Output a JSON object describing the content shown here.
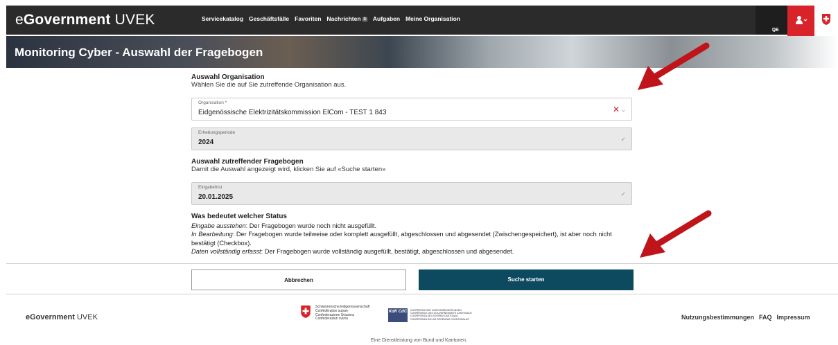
{
  "header": {
    "brand_prefix": "e",
    "brand_main": "Government",
    "brand_suffix": " UVEK",
    "nav": [
      {
        "label": "Servicekatalog"
      },
      {
        "label": "Geschäftsfälle"
      },
      {
        "label": "Favoriten"
      },
      {
        "label": "Nachrichten",
        "badge": "3"
      },
      {
        "label": "Aufgaben"
      },
      {
        "label": "Meine Organisation"
      }
    ],
    "language": "DE",
    "icons": {
      "language_dropdown": "chevron-down-icon",
      "user": "user-icon",
      "flag": "swiss-cross-icon"
    }
  },
  "hero": {
    "title": "Monitoring Cyber - Auswahl der Fragebogen"
  },
  "org_section": {
    "title": "Auswahl Organisation",
    "subtitle": "Wählen Sie die auf Sie zutreffende Organisation aus."
  },
  "fields": {
    "organisation": {
      "label": "Organisation *",
      "value": "Eidgenössische Elektrizitätskommission ElCom - TEST 1 843"
    },
    "period": {
      "label": "Erhebungsperiode",
      "value": "2024"
    },
    "deadline": {
      "label": "Eingabefrist",
      "value": "20.01.2025"
    }
  },
  "questionnaire_section": {
    "title": "Auswahl zutreffender Fragebogen",
    "subtitle": "Damit die Auswahl angezeigt wird, klicken Sie auf «Suche starten»"
  },
  "status_info": {
    "title": "Was bedeutet welcher Status",
    "items": [
      {
        "term": "Eingabe ausstehen",
        "text": ": Der Fragebogen wurde noch nicht ausgefüllt."
      },
      {
        "term": "In Bearbeitung",
        "text": ": Der Fragebogen wurde teilweise oder komplett ausgefüllt, abgeschlossen und abgesendet (Zwischengespeichert), ist aber noch nicht bestätigt (Checkbox)."
      },
      {
        "term": "Daten vollständig erfasst",
        "text": ": Der Fragebogen wurde vollständig ausgefüllt, bestätigt, abgeschlossen und abgesendet."
      }
    ]
  },
  "actions": {
    "cancel": "Abbrechen",
    "search": "Suche starten"
  },
  "footer": {
    "brand_main": "eGovernment",
    "brand_suffix": " UVEK",
    "federation": [
      "Schweizerische Eidgenossenschaft",
      "Confédération suisse",
      "Confederazione Svizzera",
      "Confederaziun svizra"
    ],
    "kdk_logo": "KdK CdC",
    "kdk": [
      "KONFERENZ DER KANTONSREGIERUNGEN",
      "CONFÉRENCE DES GOUVERNEMENTS CANTONAUX",
      "CONFERENZA DEI GOVERNI CANTONALI",
      "CONFERENZA DA LAS REGENZAS CHANTUNALAS"
    ],
    "links": [
      "Nutzungsbestimmungen",
      "FAQ",
      "Impressum"
    ],
    "note": "Eine Dienstleistung von Bund und Kantonen."
  },
  "colors": {
    "topbar": "#2b2b2b",
    "accent_red": "#d8232a",
    "primary_button": "#0e4a5f"
  }
}
